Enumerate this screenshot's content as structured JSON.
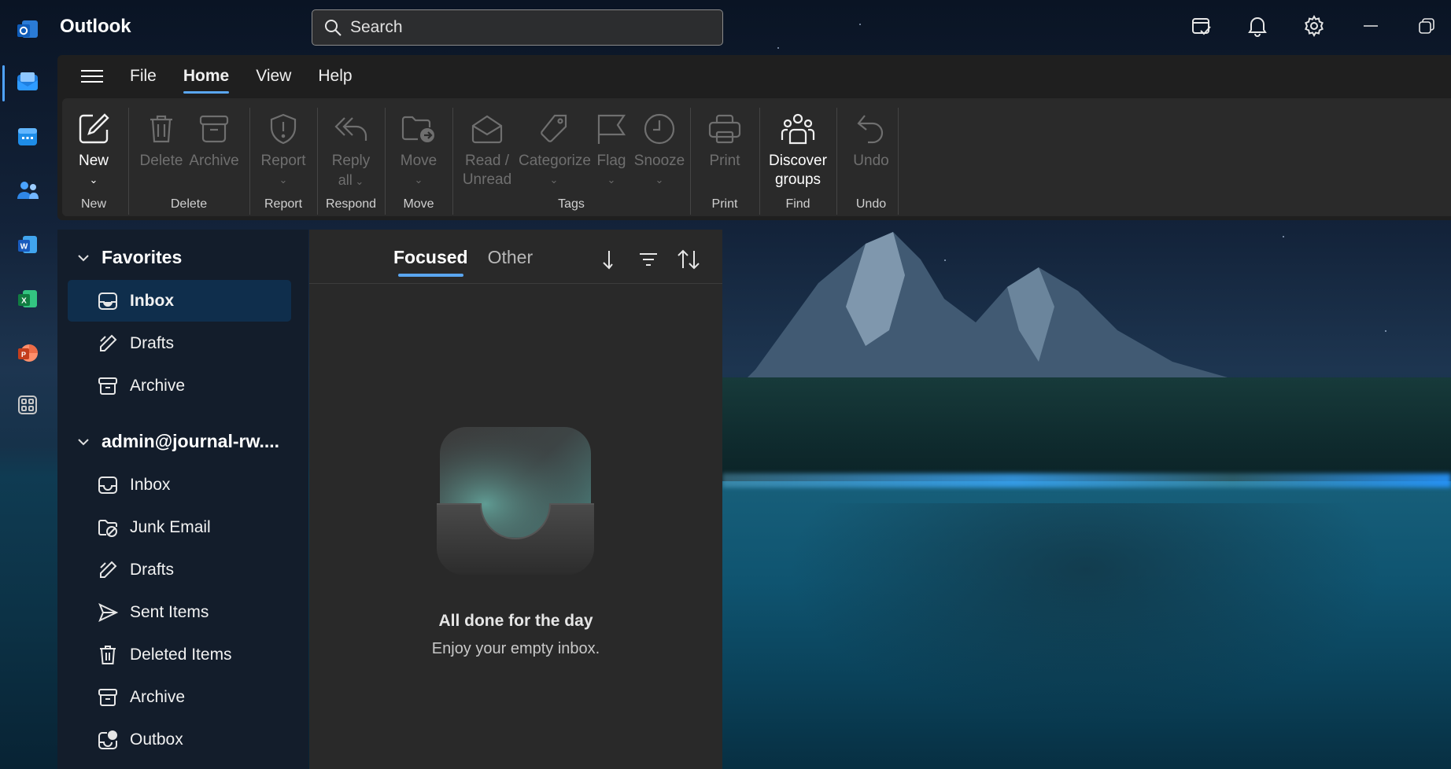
{
  "app": {
    "name": "Outlook"
  },
  "search": {
    "placeholder": "Search"
  },
  "menubar": {
    "items": [
      "File",
      "Home",
      "View",
      "Help"
    ],
    "active": "Home"
  },
  "ribbon": {
    "groups": [
      {
        "label": "New",
        "tools": [
          {
            "label": "New",
            "icon": "compose-icon",
            "enabled": true
          }
        ]
      },
      {
        "label": "Delete",
        "tools": [
          {
            "label": "Delete",
            "icon": "trash-icon"
          },
          {
            "label": "Archive",
            "icon": "archive-icon"
          }
        ]
      },
      {
        "label": "Report",
        "tools": [
          {
            "label": "Report",
            "icon": "shield-icon"
          }
        ]
      },
      {
        "label": "Respond",
        "tools": [
          {
            "label": "Reply all",
            "label_line1": "Reply",
            "label_line2": "all",
            "icon": "reply-all-icon"
          }
        ]
      },
      {
        "label": "Move",
        "tools": [
          {
            "label": "Move",
            "icon": "move-folder-icon"
          }
        ]
      },
      {
        "label": "Tags",
        "tools": [
          {
            "label": "Read / Unread",
            "label_line1": "Read /",
            "label_line2": "Unread",
            "icon": "envelope-icon"
          },
          {
            "label": "Categorize",
            "icon": "tag-icon"
          },
          {
            "label": "Flag",
            "icon": "flag-icon"
          },
          {
            "label": "Snooze",
            "icon": "clock-icon"
          }
        ]
      },
      {
        "label": "Print",
        "tools": [
          {
            "label": "Print",
            "icon": "printer-icon"
          }
        ]
      },
      {
        "label": "Find",
        "tools": [
          {
            "label": "Discover groups",
            "label_line1": "Discover",
            "label_line2": "groups",
            "icon": "people-group-icon",
            "enabled": true
          }
        ]
      },
      {
        "label": "Undo",
        "tools": [
          {
            "label": "Undo",
            "icon": "undo-icon"
          }
        ]
      }
    ]
  },
  "folders": {
    "favorites": {
      "title": "Favorites",
      "items": [
        {
          "label": "Inbox",
          "icon": "inbox-icon",
          "selected": true
        },
        {
          "label": "Drafts",
          "icon": "pencil-icon"
        },
        {
          "label": "Archive",
          "icon": "archive-icon"
        }
      ]
    },
    "account": {
      "title": "admin@journal-rw....",
      "items": [
        {
          "label": "Inbox",
          "icon": "inbox-icon"
        },
        {
          "label": "Junk Email",
          "icon": "junk-icon"
        },
        {
          "label": "Drafts",
          "icon": "pencil-icon"
        },
        {
          "label": "Sent Items",
          "icon": "send-icon"
        },
        {
          "label": "Deleted Items",
          "icon": "trash-icon"
        },
        {
          "label": "Archive",
          "icon": "archive-icon"
        },
        {
          "label": "Outbox",
          "icon": "outbox-icon"
        }
      ]
    }
  },
  "message_list": {
    "tabs": [
      "Focused",
      "Other"
    ],
    "active_tab": "Focused",
    "empty_title": "All done for the day",
    "empty_subtitle": "Enjoy your empty inbox."
  },
  "colors": {
    "accent": "#5aa6f0",
    "ribbon": "#2a2a2a",
    "folder_pane": "#131d2b",
    "list_pane": "#292929",
    "selected_folder": "#0f2e4c"
  }
}
